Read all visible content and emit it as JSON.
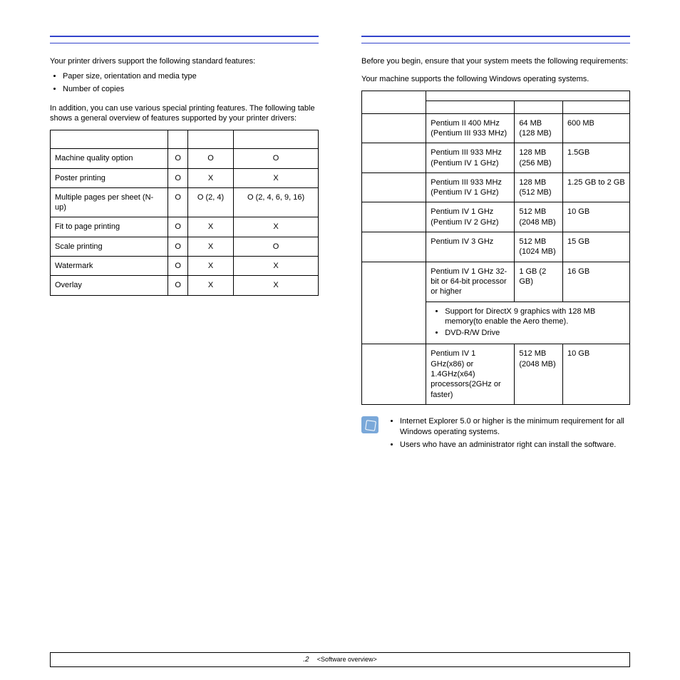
{
  "left": {
    "intro1": "Your printer drivers support the following standard features:",
    "bullets1": [
      "Paper size, orientation and media type",
      "Number of copies"
    ],
    "intro2": "In addition, you can use various special printing features. The following table shows a general overview of features supported by your printer drivers:",
    "features": {
      "rows": [
        {
          "f": "Machine quality option",
          "c2": "O",
          "c3": "O",
          "c4": "O"
        },
        {
          "f": "Poster printing",
          "c2": "O",
          "c3": "X",
          "c4": "X"
        },
        {
          "f": "Multiple pages per sheet (N-up)",
          "c2": "O",
          "c3": "O (2, 4)",
          "c4": "O (2, 4, 6, 9, 16)"
        },
        {
          "f": "Fit to page printing",
          "c2": "O",
          "c3": "X",
          "c4": "X"
        },
        {
          "f": "Scale printing",
          "c2": "O",
          "c3": "X",
          "c4": "O"
        },
        {
          "f": "Watermark",
          "c2": "O",
          "c3": "X",
          "c4": "X"
        },
        {
          "f": "Overlay",
          "c2": "O",
          "c3": "X",
          "c4": "X"
        }
      ]
    }
  },
  "right": {
    "intro1": "Before you begin, ensure that your system meets the following requirements:",
    "intro2": "Your machine supports the following Windows operating systems.",
    "req": {
      "rows": [
        {
          "cpu": "Pentium II 400 MHz (Pentium III 933 MHz)",
          "ram": "64 MB (128 MB)",
          "hdd": "600 MB"
        },
        {
          "cpu": "Pentium III 933 MHz (Pentium IV 1 GHz)",
          "ram": "128 MB (256 MB)",
          "hdd": "1.5GB"
        },
        {
          "cpu": "Pentium III 933 MHz (Pentium IV 1 GHz)",
          "ram": "128 MB (512 MB)",
          "hdd": "1.25 GB to 2 GB"
        },
        {
          "cpu": "Pentium IV 1 GHz (Pentium IV 2 GHz)",
          "ram": "512 MB (2048 MB)",
          "hdd": "10 GB"
        },
        {
          "cpu": "Pentium IV 3 GHz",
          "ram": "512 MB (1024 MB)",
          "hdd": "15 GB"
        },
        {
          "cpu": "Pentium IV 1 GHz 32-bit or 64-bit processor or higher",
          "ram": "1 GB (2 GB)",
          "hdd": "16 GB"
        }
      ],
      "spannote": [
        "Support for DirectX 9 graphics with 128 MB memory(to enable the Aero theme).",
        "DVD-R/W Drive"
      ],
      "lastrow": {
        "cpu": "Pentium IV 1 GHz(x86) or 1.4GHz(x64) processors(2GHz or faster)",
        "ram": "512 MB (2048 MB)",
        "hdd": "10 GB"
      }
    },
    "notes": [
      "Internet Explorer 5.0 or higher is the minimum requirement for all Windows operating systems.",
      "Users who have an administrator right can install the software."
    ]
  },
  "footer": {
    "page": ".2",
    "label": "<Software overview>"
  }
}
